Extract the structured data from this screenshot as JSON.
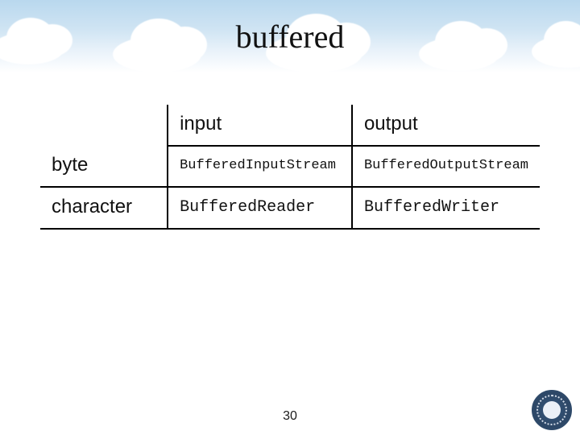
{
  "title": "buffered",
  "table": {
    "columns": [
      "input",
      "output"
    ],
    "rows": [
      {
        "label": "byte",
        "input": "BufferedInputStream",
        "output": "BufferedOutputStream"
      },
      {
        "label": "character",
        "input": "BufferedReader",
        "output": "BufferedWriter"
      }
    ]
  },
  "page_number": "30"
}
